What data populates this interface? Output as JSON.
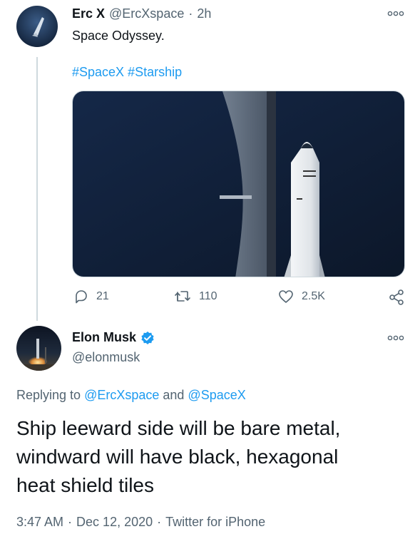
{
  "tweet1": {
    "name": "Erc X",
    "handle": "@ErcXspace",
    "separator": "·",
    "time": "2h",
    "text": "Space Odyssey.",
    "hashtags": "#SpaceX #Starship",
    "actions": {
      "replies": "21",
      "retweets": "110",
      "likes": "2.5K"
    }
  },
  "tweet2": {
    "name": "Elon Musk",
    "handle": "@elonmusk",
    "replying_prefix": "Replying to",
    "replying_user1": "@ErcXspace",
    "replying_and": "and",
    "replying_user2": "@SpaceX",
    "text_line1": "Ship leeward side will be bare metal,",
    "text_line2": "windward will have black, hexagonal",
    "text_line3": "heat shield tiles",
    "time": "3:47 AM",
    "dot1": "·",
    "date": "Dec 12, 2020",
    "dot2": "·",
    "source": "Twitter for iPhone"
  },
  "colors": {
    "link": "#1d9bf0",
    "secondary_text": "#536471",
    "verified": "#1d9bf0",
    "media_bg": "#14223a"
  },
  "icons": [
    "more-icon",
    "reply-icon",
    "retweet-icon",
    "like-icon",
    "share-icon",
    "verified-icon"
  ]
}
